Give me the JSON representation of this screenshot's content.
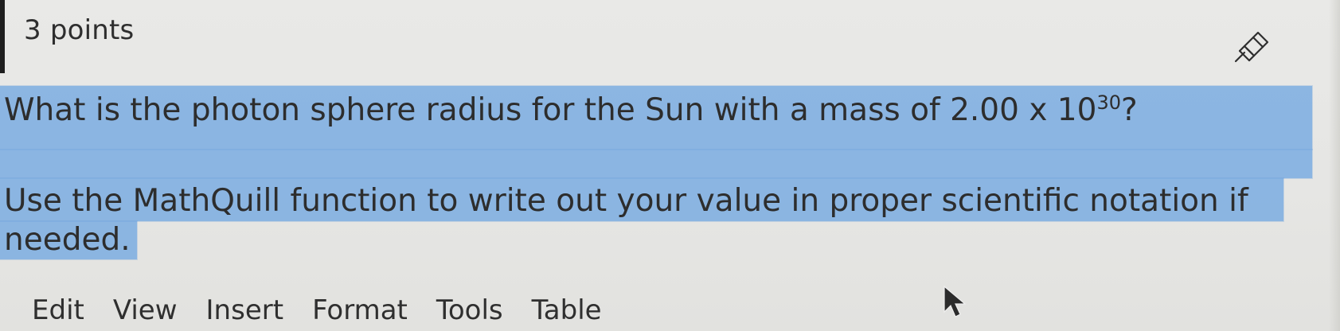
{
  "question": {
    "points_label": "3 points",
    "line1_prefix": "What is the photon sphere radius for the Sun with a mass of 2.00 x 10",
    "line1_sup": "30",
    "line1_suffix": "?",
    "line2": "Use the MathQuill function to write out your value in proper scientific notation if",
    "line3": "needed."
  },
  "toolbar": {
    "edit": "Edit",
    "view": "View",
    "insert": "Insert",
    "format": "Format",
    "tools": "Tools",
    "table": "Table"
  },
  "icons": {
    "pin": "pin-icon",
    "cursor": "mouse-cursor-icon"
  },
  "colors": {
    "highlight": "#68a2e1",
    "text": "#2d2d2d",
    "background": "#e7e7e4"
  }
}
